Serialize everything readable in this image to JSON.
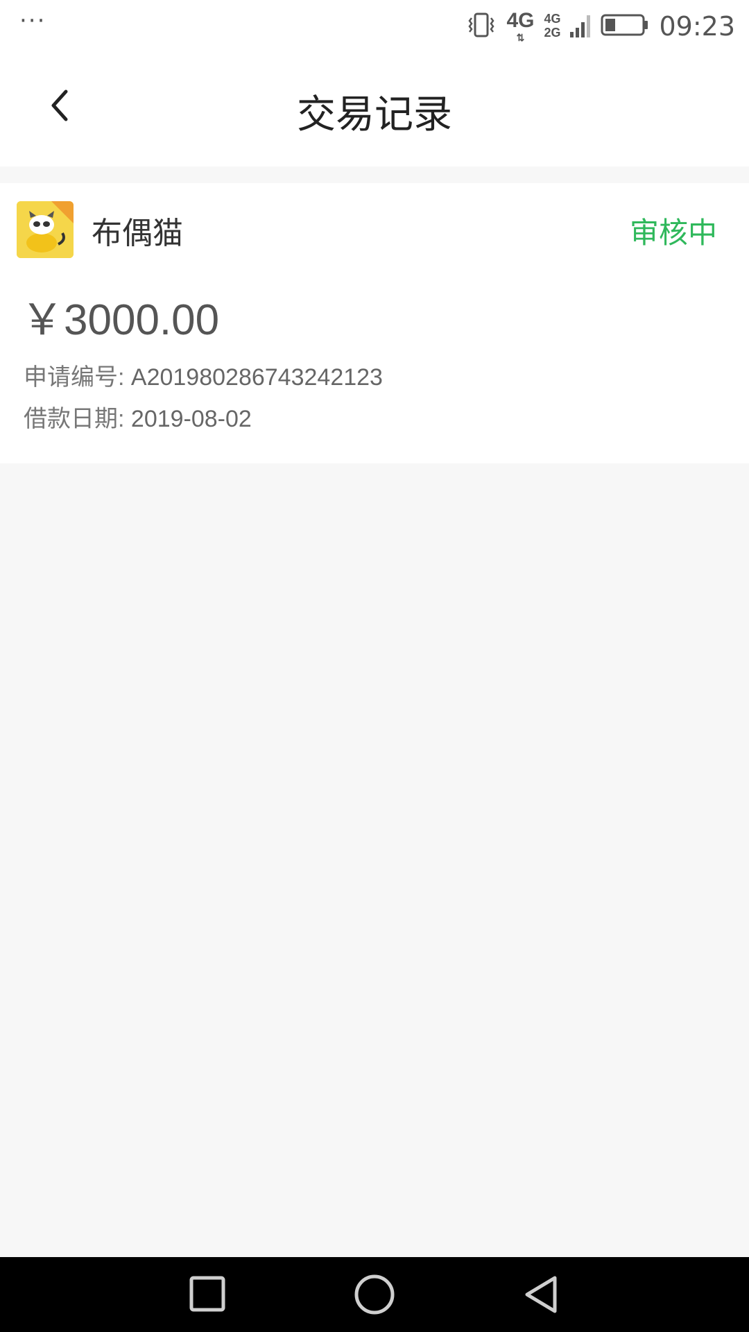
{
  "status_bar": {
    "overflow_dots": "···",
    "network_primary": "4G",
    "network_secondary_top": "4G",
    "network_secondary_bottom": "2G",
    "time": "09:23",
    "icons": [
      "vibrate-icon",
      "signal-icon",
      "battery-icon"
    ]
  },
  "header": {
    "back_icon": "chevron-left-icon",
    "title": "交易记录"
  },
  "record": {
    "app_name": "布偶猫",
    "status": "审核中",
    "amount": "￥3000.00",
    "application_no_label": "申请编号:",
    "application_no": "A201980286743242123",
    "loan_date_label": "借款日期:",
    "loan_date": "2019-08-02"
  },
  "colors": {
    "status_green": "#2fb85b",
    "background": "#f7f7f7",
    "logo_yellow": "#f5d64a"
  },
  "system_nav": {
    "icons": [
      "recent-apps-icon",
      "home-icon",
      "back-triangle-icon"
    ]
  }
}
